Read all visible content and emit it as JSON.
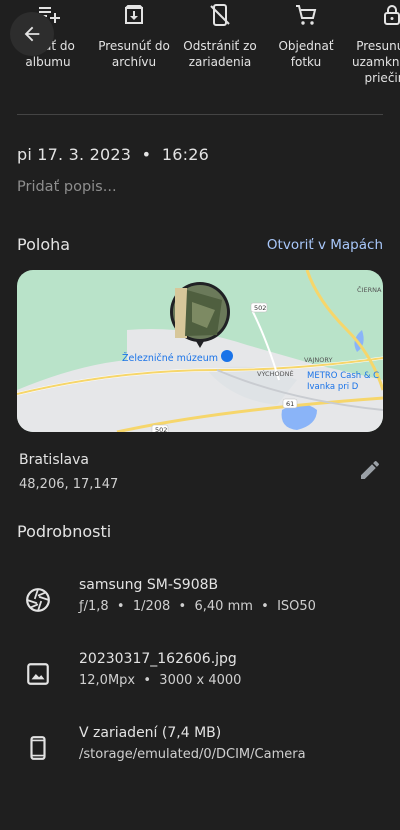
{
  "actions": [
    {
      "label": "Pridať do\nalbumu",
      "icon": "playlist-add-icon"
    },
    {
      "label": "Presunúť do\narchívu",
      "icon": "archive-icon"
    },
    {
      "label": "Odstrániť zo\nzariadenia",
      "icon": "phone-delete-icon"
    },
    {
      "label": "Objednať\nfotku",
      "icon": "shopping-cart-icon"
    },
    {
      "label": "Presunúť do\nuzamknutého\npriečinka",
      "icon": "lock-icon"
    }
  ],
  "datetime": "pi 17. 3. 2023  •  16:26",
  "add_description_placeholder": "Pridať popis...",
  "location": {
    "title": "Poloha",
    "open_in_maps": "Otvoriť v Mapách",
    "place": "Bratislava",
    "coordinates": "48,206, 17,147",
    "map_labels": {
      "museum": "Železničné múzeum",
      "east": "VÝCHODNÉ",
      "vajnory": "VAJNORY",
      "metro": "METRO Cash & C",
      "ivanka": "Ivanka pri D",
      "ciern": "ČIERNA",
      "road_502a": "502",
      "road_502b": "502",
      "road_61": "61"
    },
    "colors": {
      "land": "#b9e3c9",
      "urban": "#e6e7e9",
      "road": "#f6d66b",
      "water": "#8ab4f8"
    }
  },
  "details": {
    "title": "Podrobnosti",
    "rows": [
      {
        "icon": "camera-aperture-icon",
        "line1": "samsung SM-S908B",
        "line2": "ƒ/1,8  •  1/208  •  6,40 mm  •  ISO50"
      },
      {
        "icon": "image-icon",
        "line1": "20230317_162606.jpg",
        "line2": "12,0Mpx  •  3000 x 4000"
      },
      {
        "icon": "phone-icon",
        "line1": "V zariadení (7,4 MB)",
        "line2": "/storage/emulated/0/DCIM/Camera"
      }
    ]
  }
}
